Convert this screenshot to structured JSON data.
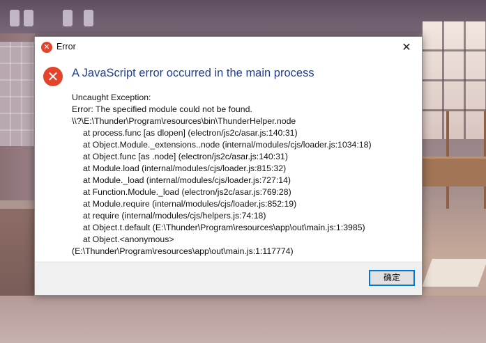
{
  "window": {
    "title": "Error",
    "close_glyph": "✕"
  },
  "icons": {
    "title_icon": "error-icon",
    "main_icon": "error-icon",
    "error_glyph": "✕",
    "error_color": "#e3442b"
  },
  "dialog": {
    "heading": "A JavaScript error occurred in the main process",
    "heading_color": "#1c3e96",
    "lines": [
      "Uncaught Exception:",
      "Error: The specified module could not be found.",
      "\\\\?\\E:\\Thunder\\Program\\resources\\bin\\ThunderHelper.node"
    ],
    "stack": [
      "at process.func [as dlopen] (electron/js2c/asar.js:140:31)",
      "at Object.Module._extensions..node (internal/modules/cjs/loader.js:1034:18)",
      "at Object.func [as .node] (electron/js2c/asar.js:140:31)",
      "at Module.load (internal/modules/cjs/loader.js:815:32)",
      "at Module._load (internal/modules/cjs/loader.js:727:14)",
      "at Function.Module._load (electron/js2c/asar.js:769:28)",
      "at Module.require (internal/modules/cjs/loader.js:852:19)",
      "at require (internal/modules/cjs/helpers.js:74:18)",
      "at Object.t.default (E:\\Thunder\\Program\\resources\\app\\out\\main.js:1:3985)",
      "at Object.<anonymous>"
    ],
    "trailer": "(E:\\Thunder\\Program\\resources\\app\\out\\main.js:1:117774)"
  },
  "footer": {
    "ok_label": "确定",
    "ok_border_color": "#0078d7"
  }
}
